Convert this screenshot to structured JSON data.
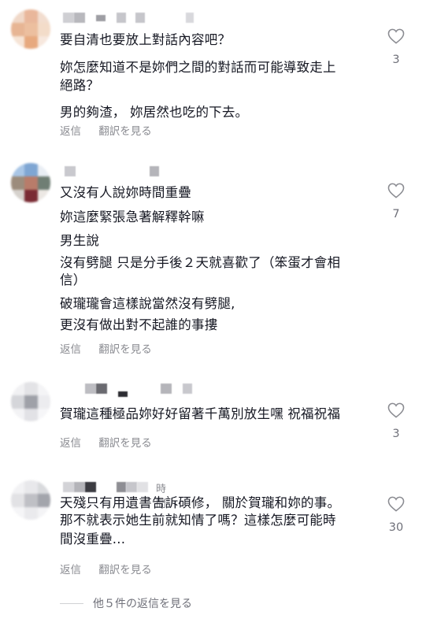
{
  "comments": [
    {
      "lines": [
        "要自清也要放上對話內容吧？",
        "妳怎麼知道不是妳們之間的對話而可能導致走上",
        "絕路？",
        "男的夠渣，  妳居然也吃的下去。"
      ],
      "reply_label": "返信",
      "translate_label": "翻訳を見る",
      "likes": "3"
    },
    {
      "lines": [
        "又沒有人說妳時間重疊",
        "妳這麼緊張急著解釋幹嘛",
        "男生說",
        "沒有劈腿 只是分手後２天就喜歡了（笨蛋才會相",
        "信）",
        "破瓏瓏會這樣說當然沒有劈腿,",
        "更沒有做出對不起誰的事摟"
      ],
      "reply_label": "返信",
      "translate_label": "翻訳を見る",
      "likes": "7"
    },
    {
      "lines": [
        "賀瓏這種極品妳好好留著千萬別放生嘿 祝福祝福"
      ],
      "reply_label": "返信",
      "translate_label": "翻訳を見る",
      "likes": "3"
    },
    {
      "header_text": "時間",
      "lines": [
        "天殘只有用遺書告訴碩修，  關於賀瓏和妳的事。",
        "那不就表示她生前就知情了嗎？這樣怎麼可能時",
        "間沒重疊..."
      ],
      "reply_label": "返信",
      "translate_label": "翻訳を見る",
      "likes": "30"
    }
  ],
  "view_more_replies": "他５件の返信を見る",
  "icons": {
    "like": "heart-outline-icon"
  },
  "colors": {
    "text": "#161823",
    "muted": "#8a8b91",
    "like_icon": "#8a8b91"
  }
}
